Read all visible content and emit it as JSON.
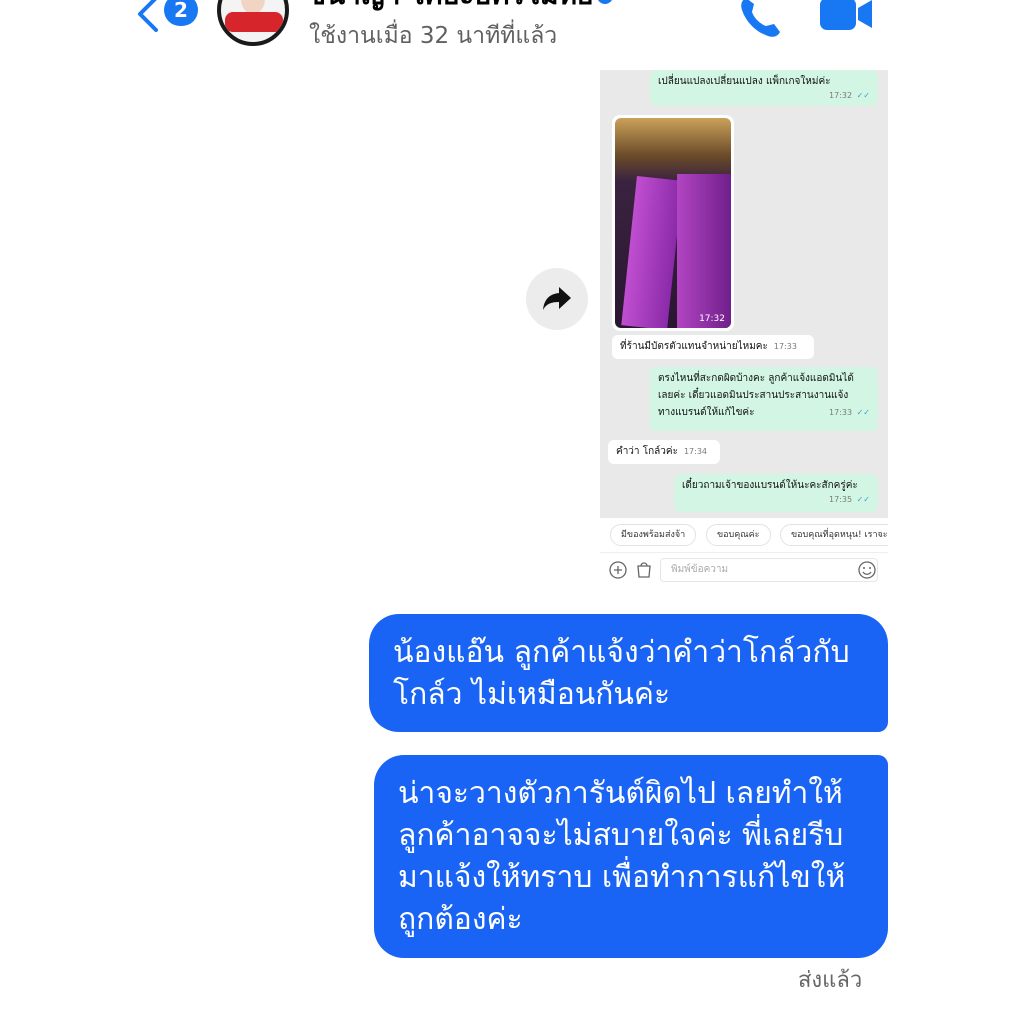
{
  "header": {
    "back_badge": "2",
    "title": "ชนาญา ไคยะอัครโมทย์",
    "status": "ใช้งานเมื่อ 32 นาทีที่แล้ว",
    "accent": "#1877f2"
  },
  "shared_screenshot": {
    "messages": [
      {
        "text": "เปลี่ยนแปลงเปลี่ยนแปลง แพ็กเกจใหม่ค่ะ",
        "time": "17:32",
        "direction": "out"
      },
      {
        "text": "",
        "time": "17:32",
        "direction": "in",
        "type": "photo"
      },
      {
        "text": "ที่ร้านมีบัตรตัวแทนจำหน่ายไหมคะ",
        "time": "17:33",
        "direction": "in"
      },
      {
        "lines": [
          "ตรงไหนที่สะกดผิดบ้างคะ ลูกค้าแจ้งแอดมินได้",
          "เลยค่ะ เดี๋ยวแอดมินประสานประสานงานแจ้ง",
          "ทางแบรนด์ให้แก้ไขค่ะ"
        ],
        "time": "17:33",
        "direction": "out"
      },
      {
        "text": "คำว่า โกล์วค่ะ",
        "time": "17:34",
        "direction": "in"
      },
      {
        "text": "เดี๋ยวถามเจ้าของแบรนด์ให้นะคะสักครู่ค่ะ",
        "time": "17:35",
        "direction": "out"
      }
    ],
    "chips": [
      "มีของพร้อมส่งจ้า",
      "ขอบคุณค่ะ",
      "ขอบคุณที่อุดหนุน! เราจะ"
    ],
    "input_placeholder": "พิมพ์ข้อความ",
    "tick": "✓✓"
  },
  "messages": [
    {
      "lines": [
        "น้องแอ๊น ลูกค้าแจ้งว่าคำว่าโกล์วกับ",
        "โกล์ว ไม่เหมือนกันค่ะ"
      ]
    },
    {
      "lines": [
        "น่าจะวางตัวการันต์ผิดไป เลยทำให้",
        "ลูกค้าอาจจะไม่สบายใจค่ะ พี่เลยรีบ",
        "มาแจ้งให้ทราบ เพื่อทำการแก้ไขให้",
        "ถูกต้องค่ะ"
      ]
    }
  ],
  "sent_status": "ส่งแล้ว",
  "colors": {
    "bubble": "#1964f5",
    "shared_out": "#d2f5e4"
  }
}
